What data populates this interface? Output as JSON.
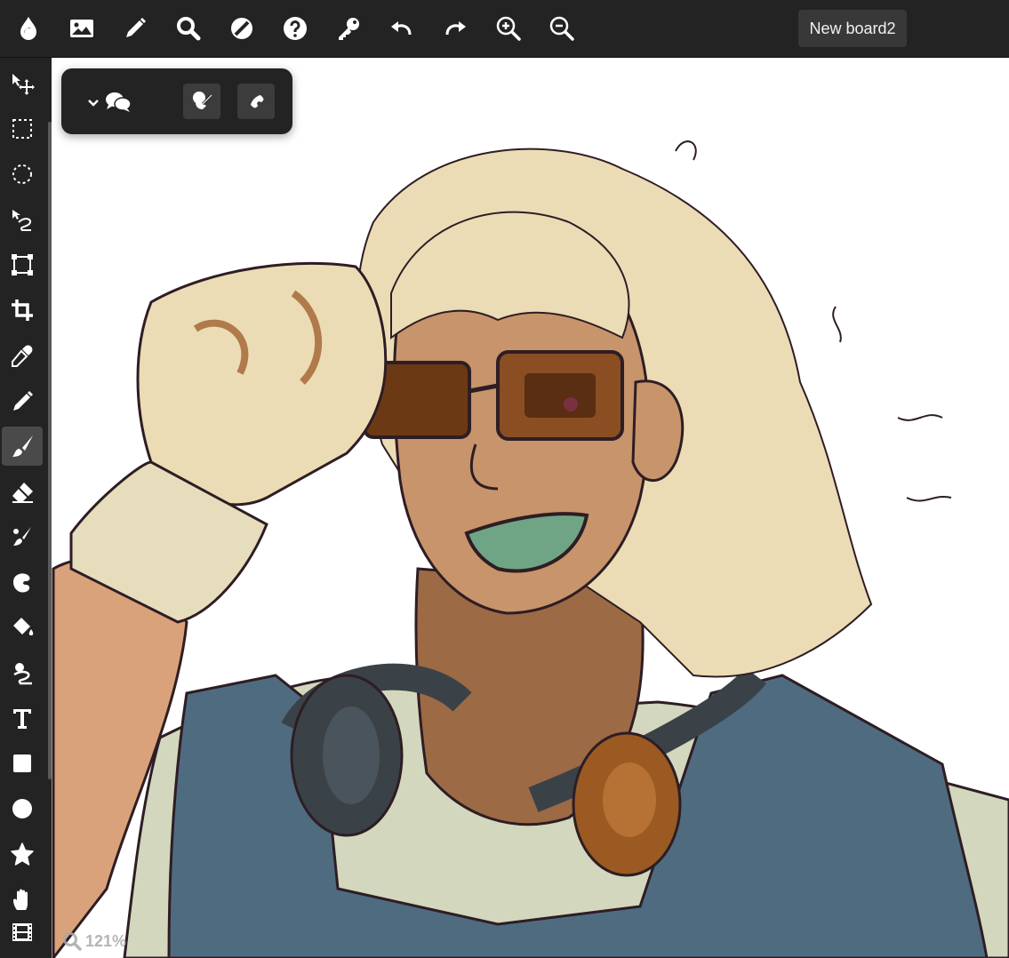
{
  "board": {
    "name": "New board2"
  },
  "zoom": {
    "level": "121%"
  },
  "toolbar": {
    "buttons": [
      "logo-icon",
      "image-icon",
      "pencil-icon",
      "search-icon",
      "contrast-icon",
      "help-icon",
      "key-icon",
      "undo-icon",
      "redo-icon",
      "zoom-in-icon",
      "zoom-out-icon"
    ]
  },
  "tools": {
    "items": [
      "move",
      "rect-select",
      "ellipse-select",
      "lasso",
      "transform",
      "crop",
      "eyedropper",
      "pen",
      "brush",
      "eraser",
      "smudge",
      "blend",
      "fill",
      "lasso-fill",
      "text",
      "rectangle",
      "ellipse",
      "star",
      "hand",
      "frames"
    ],
    "active": "brush"
  },
  "colors": {
    "ui_dark": "#232323",
    "skin": "#c7946b",
    "hair": "#ebdcb5",
    "shirt": "#d3d7bd",
    "overalls": "#4f6b80",
    "headphones": "#3a4248",
    "lens": "#6b3a14",
    "mouth": "#6fa585",
    "lineart": "#2e1d24"
  }
}
